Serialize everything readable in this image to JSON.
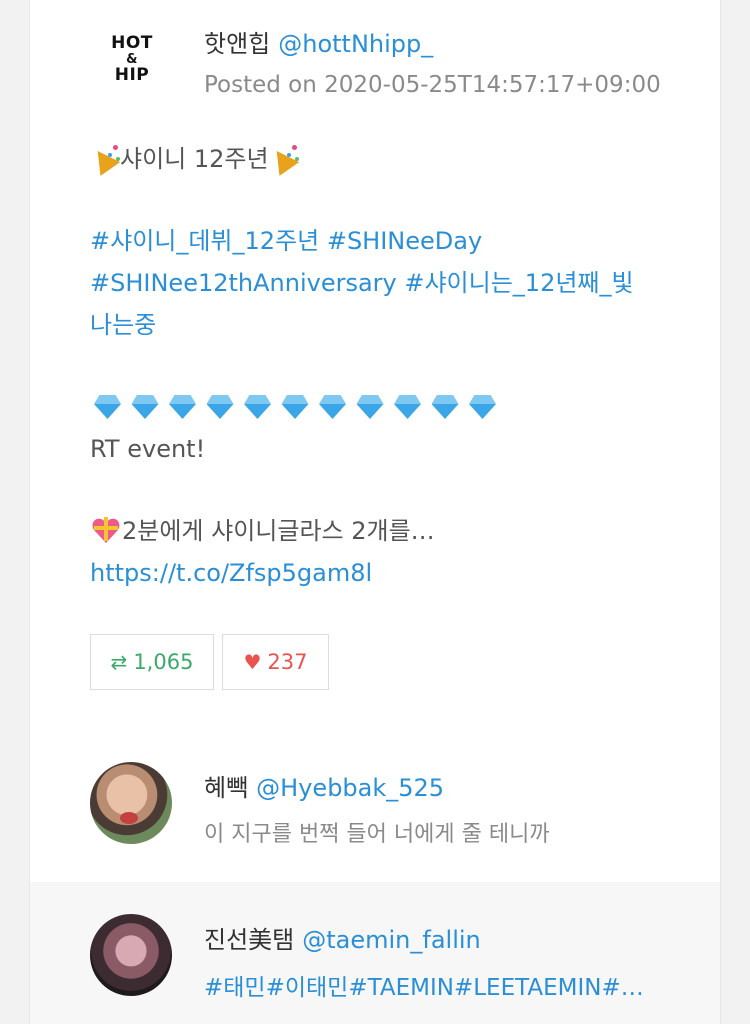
{
  "post": {
    "logo_text": [
      "HOT",
      "&",
      "HIP"
    ],
    "author_name": "핫앤힙",
    "author_handle": "@hottNhipp_",
    "posted": "Posted on 2020-05-25T14:57:17+09:00",
    "line1": "샤이니 12주년",
    "hashtags_line1": "#샤이니_데뷔_12주년 #SHINeeDay",
    "hashtags_line2": "#SHINee12thAnniversary #샤이니는_12년째_빛",
    "hashtags_line3": "나는중",
    "gem_count": 11,
    "rt_event": "RT event!",
    "gift_line": "2분에게 샤이니글라스 2개를…",
    "link": "https://t.co/Zfsp5gam8l",
    "retweets": "1,065",
    "likes": "237"
  },
  "replies": [
    {
      "name": "혜빽",
      "handle": "@Hyebbak_525",
      "text": "이 지구를 번쩍 들어 너에게 줄 테니까"
    },
    {
      "name": "진선美탬",
      "handle": "@taemin_fallin",
      "text": "#태민#이태민#TAEMIN#LEETAEMIN#…"
    }
  ],
  "colors": {
    "link": "#2a8fd6",
    "retweet": "#3aaa6a",
    "like": "#e8534f"
  },
  "icons": [
    "party-popper-icon",
    "gem-icon",
    "heart-gift-icon",
    "retweet-icon",
    "heart-icon"
  ]
}
